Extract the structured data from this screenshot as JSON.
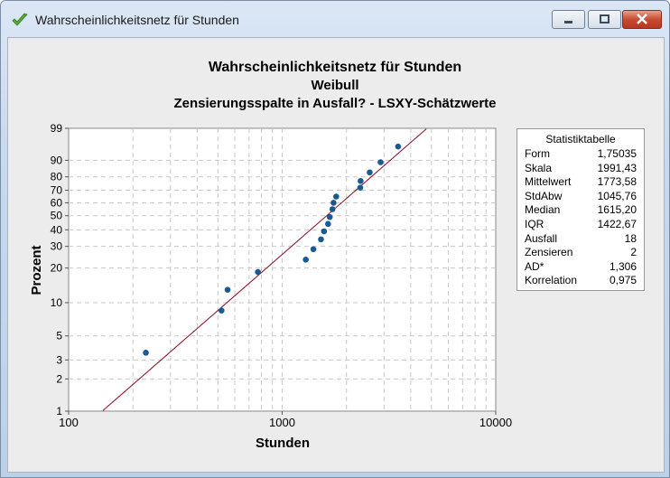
{
  "window": {
    "title": "Wahrscheinlichkeitsnetz für Stunden"
  },
  "chart_data": {
    "type": "scatter",
    "title": "Wahrscheinlichkeitsnetz für Stunden",
    "subtitle": "Weibull",
    "subtitle2": "Zensierungsspalte in Ausfall? - LSXY-Schätzwerte",
    "xlabel": "Stunden",
    "ylabel": "Prozent",
    "xscale": "log",
    "yscale": "weibull",
    "xlim": [
      100,
      10000
    ],
    "ylim": [
      1,
      99
    ],
    "x_ticks": [
      100,
      1000,
      10000
    ],
    "x_tick_labels": [
      "100",
      "1000",
      "10000"
    ],
    "y_ticks": [
      1,
      2,
      3,
      5,
      10,
      20,
      30,
      40,
      50,
      60,
      70,
      80,
      90,
      99
    ],
    "y_tick_labels": [
      "1",
      "2",
      "3",
      "5",
      "10",
      "20",
      "30",
      "40",
      "50",
      "60",
      "70",
      "80",
      "90",
      "99"
    ],
    "grid": true,
    "points": [
      {
        "x": 230,
        "y": 3.5
      },
      {
        "x": 520,
        "y": 8.5
      },
      {
        "x": 555,
        "y": 13
      },
      {
        "x": 770,
        "y": 18.5
      },
      {
        "x": 1290,
        "y": 23.5
      },
      {
        "x": 1400,
        "y": 28.5
      },
      {
        "x": 1520,
        "y": 34
      },
      {
        "x": 1570,
        "y": 39
      },
      {
        "x": 1640,
        "y": 44
      },
      {
        "x": 1670,
        "y": 49
      },
      {
        "x": 1720,
        "y": 55
      },
      {
        "x": 1740,
        "y": 60
      },
      {
        "x": 1790,
        "y": 65
      },
      {
        "x": 2320,
        "y": 72
      },
      {
        "x": 2330,
        "y": 77
      },
      {
        "x": 2570,
        "y": 83
      },
      {
        "x": 2890,
        "y": 89
      },
      {
        "x": 3490,
        "y": 95.5
      }
    ],
    "fit_line": {
      "shape": 1.75035,
      "scale": 1991.43
    },
    "colors": {
      "points": "#1a5a94",
      "fit_line": "#8b0a1e",
      "grid": "#c8c8c8"
    }
  },
  "stats": {
    "title": "Statistiktabelle",
    "rows": [
      {
        "label": "Form",
        "value": "1,75035"
      },
      {
        "label": "Skala",
        "value": "1991,43"
      },
      {
        "label": "Mittelwert",
        "value": "1773,58"
      },
      {
        "label": "StdAbw",
        "value": "1045,76"
      },
      {
        "label": "Median",
        "value": "1615,20"
      },
      {
        "label": "IQR",
        "value": "1422,67"
      },
      {
        "label": "Ausfall",
        "value": "18"
      },
      {
        "label": "Zensieren",
        "value": "2"
      },
      {
        "label": "AD*",
        "value": "1,306"
      },
      {
        "label": "Korrelation",
        "value": "0,975"
      }
    ]
  }
}
